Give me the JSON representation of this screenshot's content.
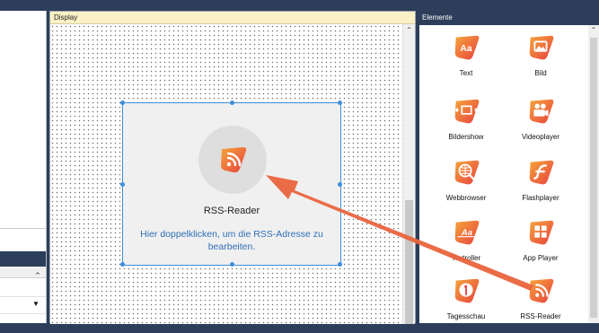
{
  "display": {
    "title": "Display",
    "widget": {
      "name": "RSS-Reader",
      "hint": "Hier doppelklicken, um die RSS-Adresse zu bearbeiten."
    }
  },
  "elements_panel": {
    "title": "Elemente",
    "items": [
      {
        "label": "Text",
        "icon": "text-aa-icon"
      },
      {
        "label": "Bild",
        "icon": "image-icon"
      },
      {
        "label": "Bildershow",
        "icon": "slideshow-icon"
      },
      {
        "label": "Videoplayer",
        "icon": "video-camera-icon"
      },
      {
        "label": "Webbrowser",
        "icon": "globe-search-icon"
      },
      {
        "label": "Flashplayer",
        "icon": "flash-icon"
      },
      {
        "label": "Textroller",
        "icon": "ticker-text-icon"
      },
      {
        "label": "App Player",
        "icon": "apps-grid-icon"
      },
      {
        "label": "Tagesschau",
        "icon": "tagesschau-icon"
      },
      {
        "label": "RSS-Reader",
        "icon": "rss-icon"
      }
    ]
  },
  "colors": {
    "header": "#2c3e5a",
    "accent_orange": "#ef7a2e",
    "accent_red": "#e8413f",
    "selection_blue": "#3c8fd9",
    "link_blue": "#2d6fb5",
    "display_title_bg": "#fbf1c6",
    "arrow": "#e9643d"
  }
}
